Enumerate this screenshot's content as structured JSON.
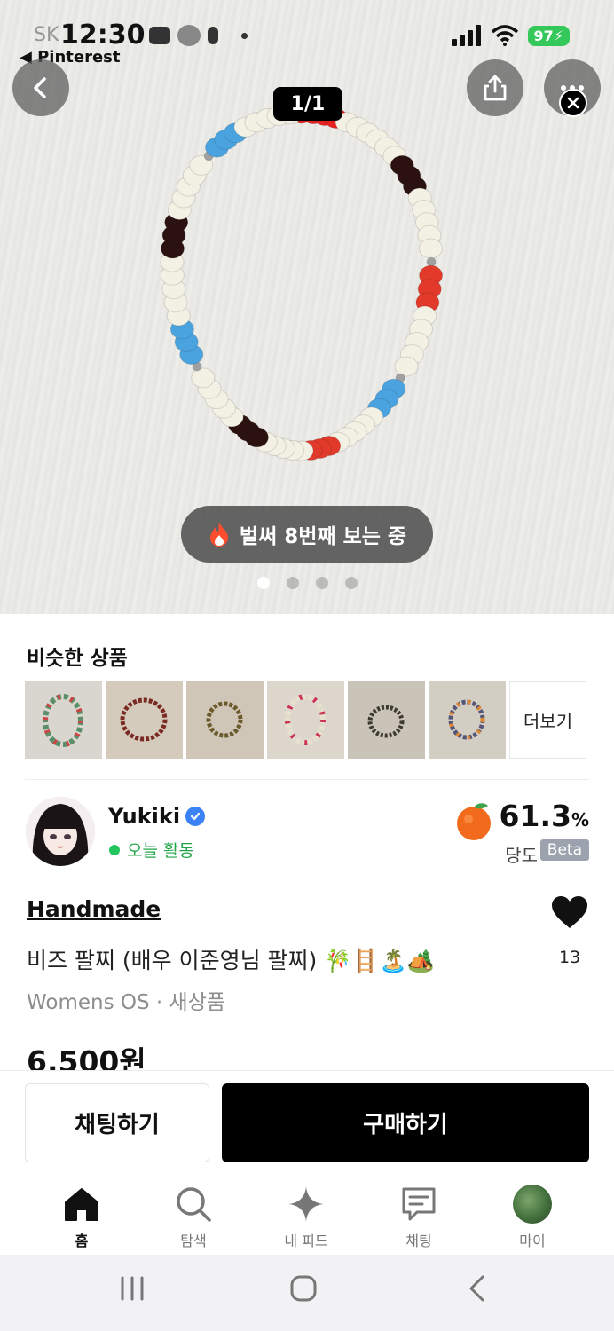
{
  "status_bar": {
    "carrier": "SK",
    "time": "12:30",
    "back_app": "◀ Pinterest",
    "battery": "97"
  },
  "image_viewer": {
    "counter": "1/1",
    "views_text": "벌써 8번째 보는 중",
    "dots": [
      true,
      false,
      false,
      false
    ]
  },
  "similar": {
    "title": "비슷한 상품",
    "more_label": "더보기",
    "thumb_count": 6
  },
  "seller": {
    "name": "Yukiki",
    "status": "오늘 활동",
    "score_value": "61.3",
    "score_unit": "%",
    "score_label": "당도",
    "beta_label": "Beta"
  },
  "product": {
    "brand": "Handmade",
    "title": "비즈 팔찌 (배우 이준영님 팔찌) 🎋🪜🏝️🏕️",
    "meta": "Womens OS · 새상품",
    "price": "6,500원",
    "likes": "13"
  },
  "actions": {
    "chat": "채팅하기",
    "buy": "구매하기"
  },
  "tabs": [
    {
      "label": "홈",
      "icon": "home-icon"
    },
    {
      "label": "탐색",
      "icon": "search-icon"
    },
    {
      "label": "내 피드",
      "icon": "sparkle-icon"
    },
    {
      "label": "채팅",
      "icon": "chat-icon"
    },
    {
      "label": "마이",
      "icon": "profile-avatar-icon"
    }
  ],
  "colors": {
    "accent_green": "#22c55e",
    "battery_green": "#34c759",
    "verified_blue": "#3b82f6",
    "buy_button": "#000000"
  }
}
